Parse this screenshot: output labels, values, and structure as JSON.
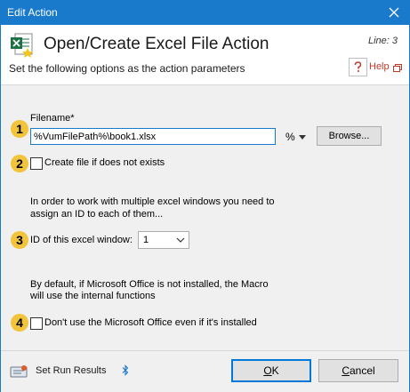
{
  "window": {
    "title": "Edit Action"
  },
  "header": {
    "title": "Open/Create Excel File Action",
    "line": "Line: 3",
    "subtitle": "Set the following options as the action parameters",
    "help_label": "Help"
  },
  "steps": [
    "1",
    "2",
    "3",
    "4"
  ],
  "filename": {
    "label": "Filename*",
    "value": "%VumFilePath%\\book1.xlsx",
    "variable_menu": "%",
    "browse_label": "Browse..."
  },
  "create_file": {
    "label": "Create file if does not exists",
    "checked": false
  },
  "window_id": {
    "info_line1": "In order to work with multiple excel windows you need to",
    "info_line2": "assign an ID to each of them...",
    "label": "ID of this excel window:",
    "value": "1"
  },
  "office": {
    "info_line1": "By default, if Microsoft Office is not installed, the Macro",
    "info_line2": "will use the internal functions",
    "checkbox_label": "Don't use the Microsoft Office even if it's installed",
    "checked": false
  },
  "footer": {
    "set_run_results": "Set Run Results",
    "ok": "OK",
    "cancel": "Cancel"
  },
  "colors": {
    "titlebar": "#1979ca",
    "badge": "#f2c43b",
    "help": "#c0392b",
    "excel_green": "#1e7145"
  },
  "icons": [
    "close-icon",
    "excel-file-icon",
    "help-icon",
    "popout-icon",
    "chevron-down-icon",
    "run-results-icon",
    "bluetooth-icon"
  ]
}
